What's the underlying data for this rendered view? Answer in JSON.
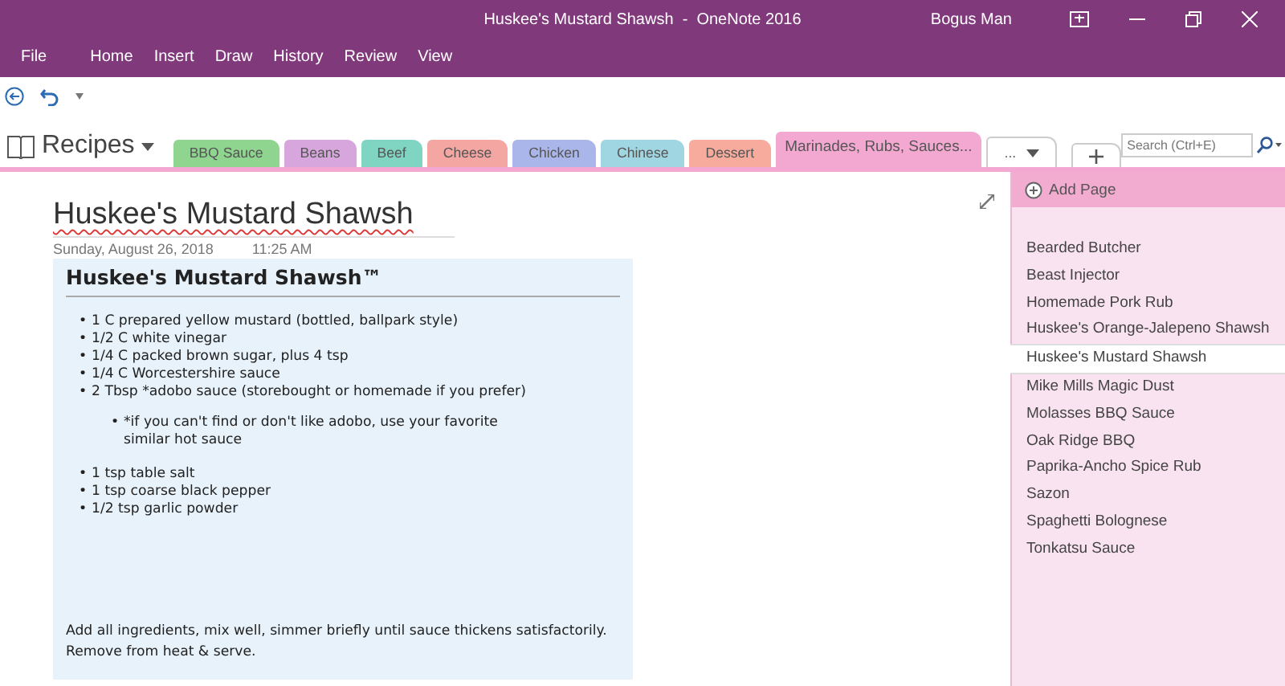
{
  "window": {
    "title": "Huskee's Mustard Shawsh  -  OneNote 2016",
    "user": "Bogus Man"
  },
  "ribbon_tabs": [
    "File",
    "Home",
    "Insert",
    "Draw",
    "History",
    "Review",
    "View"
  ],
  "notebook": {
    "name": "Recipes"
  },
  "sections": [
    {
      "label": "BBQ Sauce",
      "color": "#8fd48f",
      "selected": false
    },
    {
      "label": "Beans",
      "color": "#d7a6dc",
      "selected": false
    },
    {
      "label": "Beef",
      "color": "#80d4c2",
      "selected": false
    },
    {
      "label": "Cheese",
      "color": "#f4a6a2",
      "selected": false
    },
    {
      "label": "Chicken",
      "color": "#aab6ea",
      "selected": false
    },
    {
      "label": "Chinese",
      "color": "#9fd6e2",
      "selected": false
    },
    {
      "label": "Dessert",
      "color": "#f6ab9c",
      "selected": false
    },
    {
      "label": "Marinades, Rubs, Sauces...",
      "color": "#f2a8d0",
      "selected": true
    }
  ],
  "more_sections": {
    "label": "..."
  },
  "search": {
    "placeholder": "Search (Ctrl+E)"
  },
  "page": {
    "title": "Huskee's Mustard Shawsh",
    "date": "Sunday, August 26, 2018",
    "time": "11:25 AM",
    "note": {
      "heading": "Huskee's Mustard Shawsh™",
      "ingredients": [
        {
          "marker": "•",
          "text": "1 C prepared yellow mustard (bottled, ballpark style)"
        },
        {
          "marker": "•",
          "text": "1/2 C white vinegar"
        },
        {
          "marker": "•",
          "text": "1/4 C packed brown sugar, plus 4 tsp"
        },
        {
          "marker": "•",
          "text": "1/4 C Worcestershire sauce"
        },
        {
          "marker": "•",
          "text": "2 Tbsp *adobo sauce (storebought or homemade if you prefer)",
          "children": [
            {
              "marker": "•",
              "text": "*if you can't find or don't like adobo, use your favorite similar hot sauce"
            }
          ]
        },
        {
          "marker": "•",
          "text": "1 tsp table salt"
        },
        {
          "marker": "•",
          "text": "1 tsp coarse black pepper"
        },
        {
          "marker": "•",
          "text": "1/2 tsp garlic powder"
        }
      ],
      "instructions": "Add all ingredients, mix well, simmer briefly until sauce thickens satisfactorily. Remove from heat & serve."
    }
  },
  "pages_panel": {
    "add_page": "Add Page",
    "pages": [
      {
        "title": "Bearded Butcher",
        "selected": false
      },
      {
        "title": "Beast Injector",
        "selected": false
      },
      {
        "title": "Homemade Pork Rub",
        "selected": false
      },
      {
        "title": "Huskee's Orange-Jalepeno Shawsh",
        "selected": false
      },
      {
        "title": "Huskee's Mustard Shawsh",
        "selected": true
      },
      {
        "title": "Mike Mills Magic Dust",
        "selected": false
      },
      {
        "title": "Molasses BBQ Sauce",
        "selected": false
      },
      {
        "title": "Oak Ridge BBQ",
        "selected": false
      },
      {
        "title": "Paprika-Ancho Spice Rub",
        "selected": false
      },
      {
        "title": "Sazon",
        "selected": false
      },
      {
        "title": "Spaghetti Bolognese",
        "selected": false
      },
      {
        "title": "Tonkatsu Sauce",
        "selected": false
      }
    ]
  }
}
